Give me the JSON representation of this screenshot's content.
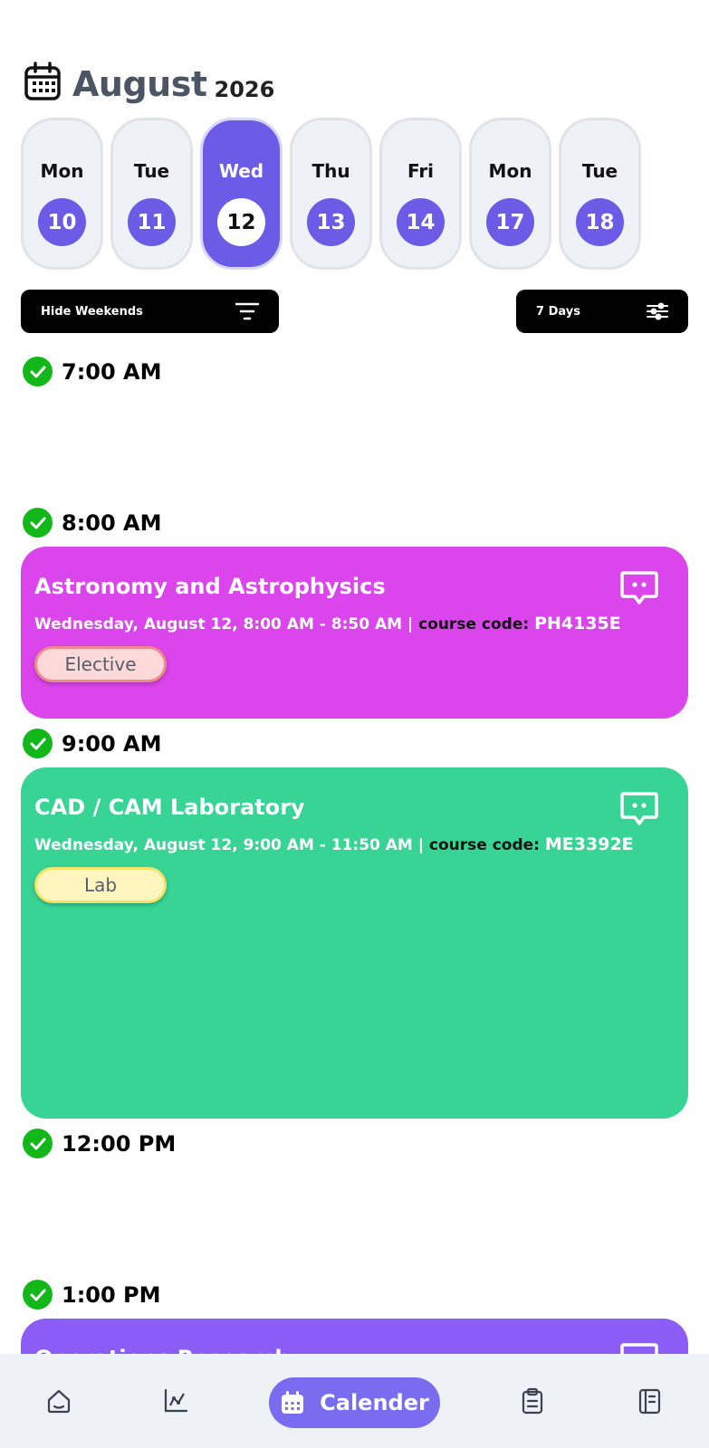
{
  "header": {
    "month": "August",
    "year": "2026"
  },
  "days": [
    {
      "name": "Mon",
      "num": "10"
    },
    {
      "name": "Tue",
      "num": "11"
    },
    {
      "name": "Wed",
      "num": "12",
      "active": true
    },
    {
      "name": "Thu",
      "num": "13"
    },
    {
      "name": "Fri",
      "num": "14"
    },
    {
      "name": "Mon",
      "num": "17"
    },
    {
      "name": "Tue",
      "num": "18"
    }
  ],
  "controls": {
    "hide_weekends": "Hide Weekends",
    "range": "7 Days"
  },
  "times": [
    "7:00 AM",
    "8:00 AM",
    "9:00 AM",
    "12:00 PM",
    "1:00 PM"
  ],
  "events": [
    {
      "title": "Astronomy and Astrophysics",
      "when": "Wednesday, August 12, 8:00 AM - 8:50 AM | ",
      "code_label": "course code: ",
      "code": "PH4135E",
      "tag": "Elective",
      "color": "#db45ec",
      "tag_bg": "#fdd9d9",
      "tag_border": "#f08a8a"
    },
    {
      "title": "CAD / CAM Laboratory",
      "when": "Wednesday, August 12, 9:00 AM - 11:50 AM | ",
      "code_label": "course code: ",
      "code": "ME3392E",
      "tag": "Lab",
      "color": "#37d495",
      "tag_bg": "#fff6bf",
      "tag_border": "#f4e36a"
    },
    {
      "title": "Operations Research",
      "color": "#8b5cf6"
    }
  ],
  "nav": {
    "active_label": "Calender",
    "accent": "#7a6cf0"
  }
}
